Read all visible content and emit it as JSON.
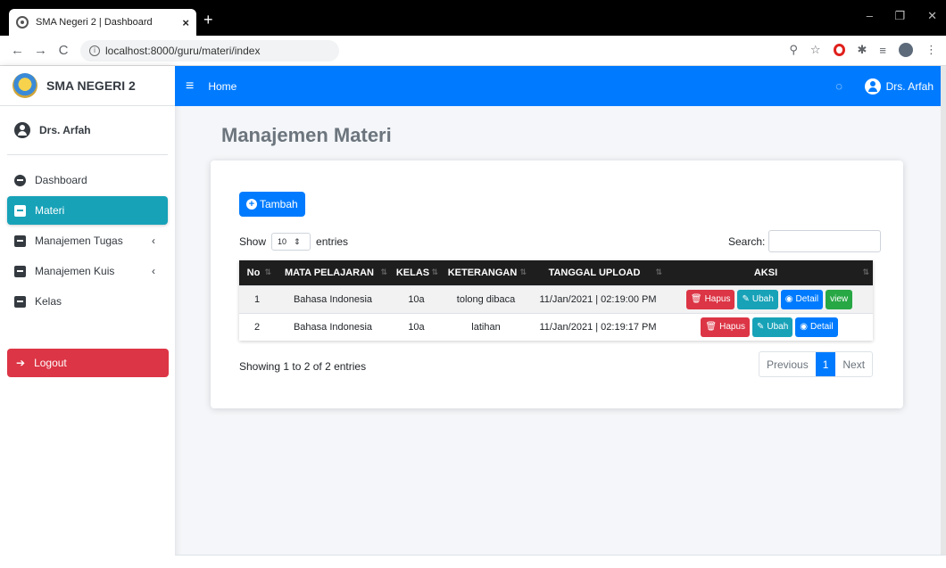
{
  "browser": {
    "tab_title": "SMA Negeri 2 | Dashboard",
    "tab_close": "×",
    "new_tab": "+",
    "url": "localhost:8000/guru/materi/index",
    "win_min": "–",
    "win_max": "❐",
    "win_close": "✕"
  },
  "sidebar": {
    "brand": "SMA NEGERI 2",
    "user": "Drs. Arfah",
    "items": [
      {
        "label": "Dashboard"
      },
      {
        "label": "Materi"
      },
      {
        "label": "Manajemen Tugas"
      },
      {
        "label": "Manajemen Kuis"
      },
      {
        "label": "Kelas"
      }
    ],
    "logout": "Logout"
  },
  "topnav": {
    "home": "Home",
    "user": "Drs. Arfah"
  },
  "page": {
    "title": "Manajemen Materi",
    "add_button": "Tambah",
    "show": "Show",
    "entries_value": "10",
    "entries": "entries",
    "search_label": "Search:",
    "info": "Showing 1 to 2 of 2 entries",
    "prev": "Previous",
    "page_num": "1",
    "next": "Next"
  },
  "table": {
    "headers": [
      "No",
      "MATA PELAJARAN",
      "KELAS",
      "KETERANGAN",
      "TANGGAL UPLOAD",
      "AKSI"
    ],
    "rows": [
      {
        "no": "1",
        "mapel": "Bahasa Indonesia",
        "kelas": "10a",
        "ket": "tolong dibaca",
        "tgl": "11/Jan/2021 | 02:19:00 PM"
      },
      {
        "no": "2",
        "mapel": "Bahasa Indonesia",
        "kelas": "10a",
        "ket": "latihan",
        "tgl": "11/Jan/2021 | 02:19:17 PM"
      }
    ],
    "actions": {
      "hapus": "Hapus",
      "ubah": "Ubah",
      "detail": "Detail",
      "view": "view"
    }
  }
}
